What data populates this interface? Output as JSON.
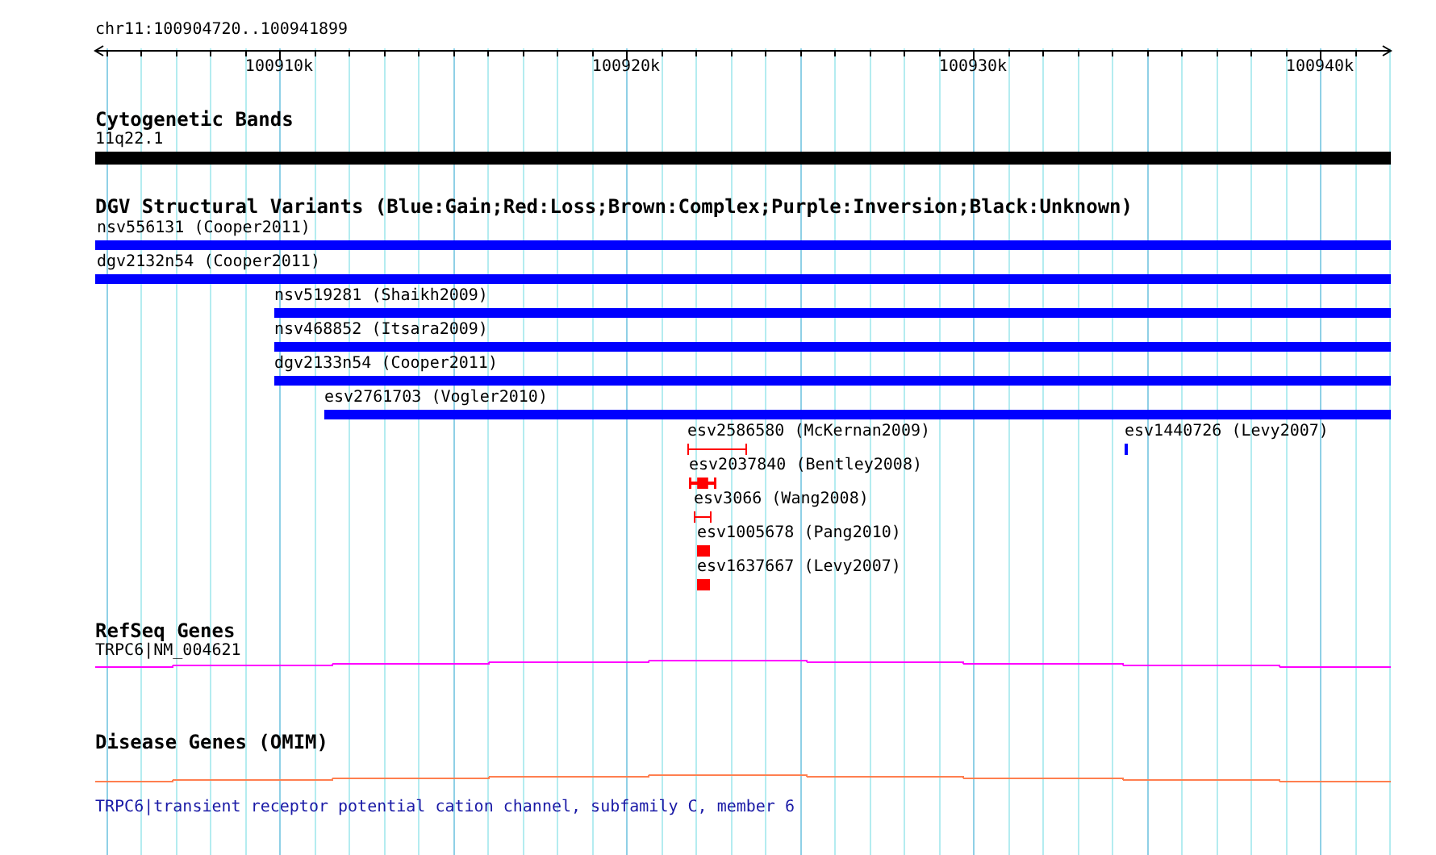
{
  "ruler": {
    "location": "chr11:100904720..100941899",
    "ticks": [
      "100910k",
      "100920k",
      "100930k",
      "100940k"
    ]
  },
  "tracks": [
    {
      "kind": "bands",
      "title": "Cytogenetic Bands",
      "features": [
        {
          "label": "11q22.1"
        }
      ]
    },
    {
      "kind": "variants",
      "title": "DGV Structural Variants (Blue:Gain;Red:Loss;Brown:Complex;Purple:Inversion;Black:Unknown)",
      "features": [
        {
          "label": "nsv556131 (Cooper2011)",
          "color": "#0000ff",
          "kind": "bar"
        },
        {
          "label": "dgv2132n54 (Cooper2011)",
          "color": "#0000ff",
          "kind": "bar"
        },
        {
          "label": "nsv519281 (Shaikh2009)",
          "color": "#0000ff",
          "kind": "bar"
        },
        {
          "label": "nsv468852 (Itsara2009)",
          "color": "#0000ff",
          "kind": "bar"
        },
        {
          "label": "dgv2133n54 (Cooper2011)",
          "color": "#0000ff",
          "kind": "bar"
        },
        {
          "label": "esv2761703 (Vogler2010)",
          "color": "#0000ff",
          "kind": "bar"
        },
        {
          "label": "esv2586580 (McKernan2009)",
          "color": "#ff0000",
          "kind": "span"
        },
        {
          "label": "esv1440726 (Levy2007)",
          "color": "#0000ff",
          "kind": "bar"
        },
        {
          "label": "esv2037840 (Bentley2008)",
          "color": "#ff0000",
          "kind": "capped-bar"
        },
        {
          "label": "esv3066 (Wang2008)",
          "color": "#ff0000",
          "kind": "span"
        },
        {
          "label": "esv1005678 (Pang2010)",
          "color": "#ff0000",
          "kind": "bar"
        },
        {
          "label": "esv1637667 (Levy2007)",
          "color": "#ff0000",
          "kind": "bar"
        }
      ]
    },
    {
      "kind": "genes",
      "title": "RefSeq Genes",
      "color": "#ff00ff",
      "features": [
        {
          "label": "TRPC6|NM_004621"
        }
      ]
    },
    {
      "kind": "disease",
      "title": "Disease Genes (OMIM)",
      "color": "#ff7f50",
      "features": [
        {
          "label": "TRPC6|transient receptor potential cation channel, subfamily C, member 6"
        }
      ]
    }
  ]
}
